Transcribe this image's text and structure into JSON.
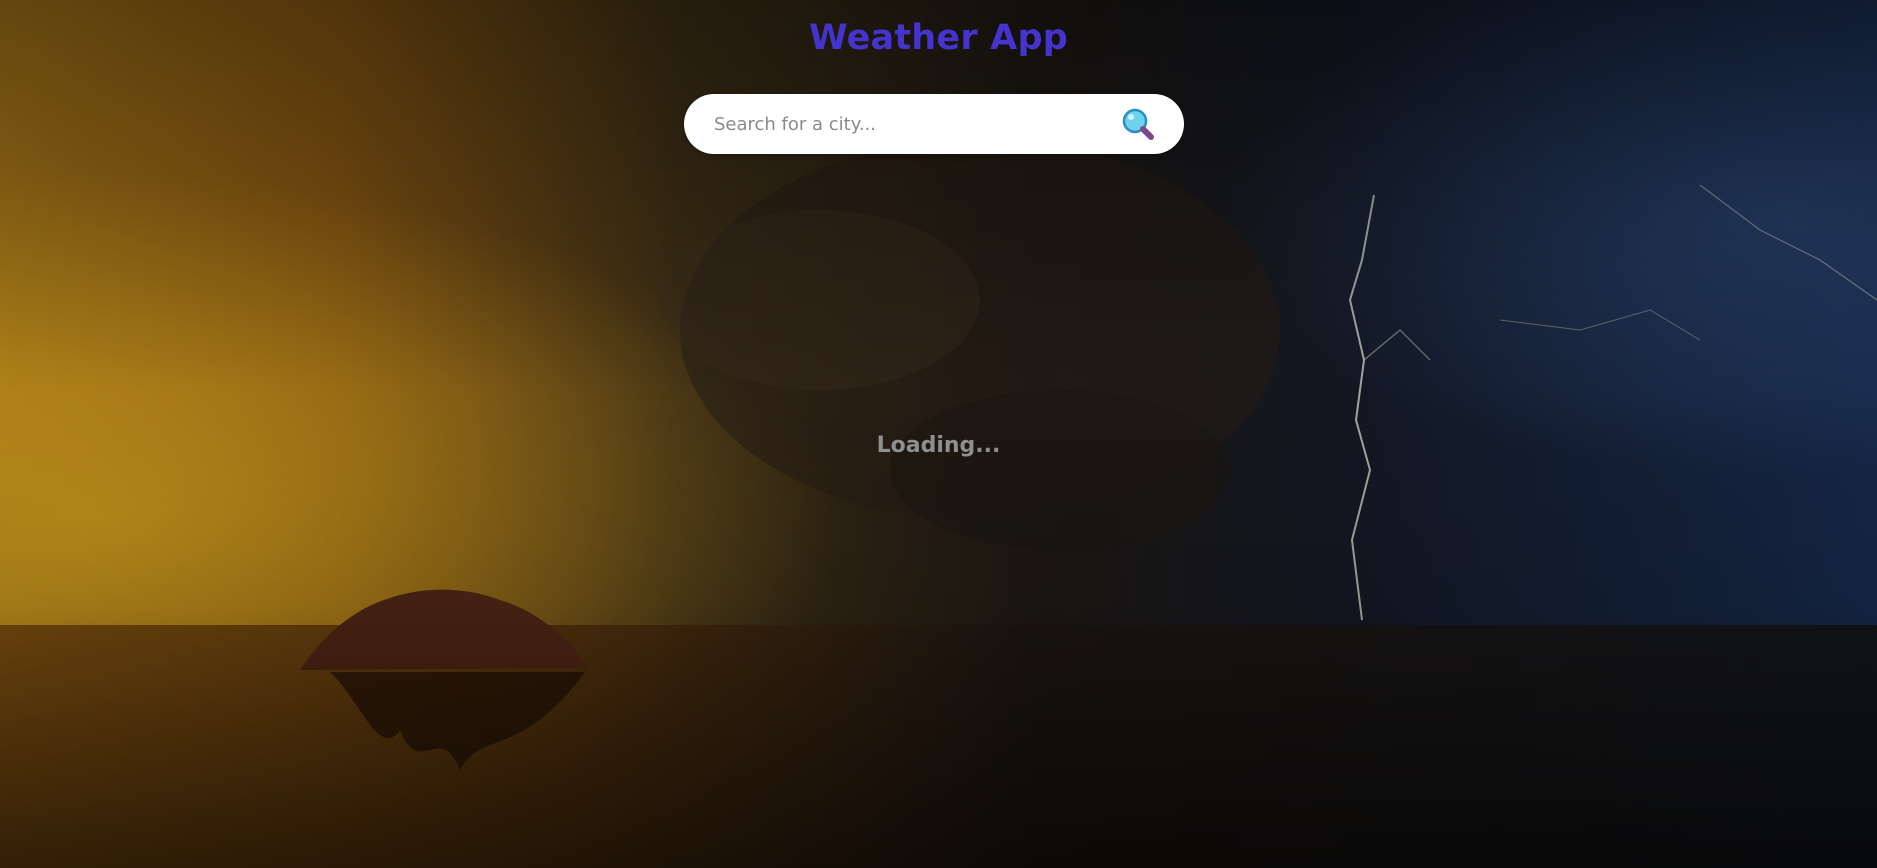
{
  "header": {
    "title": "Weather App"
  },
  "search": {
    "placeholder": "Search for a city...",
    "value": "",
    "button_icon": "magnifying-glass-icon"
  },
  "status": {
    "loading_text": "Loading..."
  },
  "colors": {
    "title": "#4433cc",
    "loading_text": "#8f8f8f",
    "search_background": "#ffffff"
  }
}
